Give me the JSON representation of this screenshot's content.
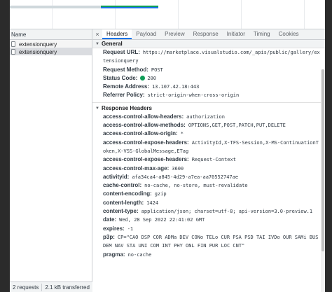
{
  "timeline": {
    "waiting_color": "#cfd8dc",
    "receiving_color": "#1a73e8"
  },
  "request_list": {
    "column_header": "Name",
    "items": [
      {
        "name": "extensionquery",
        "selected": false
      },
      {
        "name": "extensionquery",
        "selected": true
      }
    ],
    "status_bar": {
      "requests": "2 requests",
      "transferred": "2.1 kB transferred"
    }
  },
  "tabs": {
    "close_glyph": "×",
    "items": [
      "Headers",
      "Payload",
      "Preview",
      "Response",
      "Initiator",
      "Timing",
      "Cookies"
    ],
    "active": "Headers"
  },
  "general": {
    "title": "General",
    "fields": [
      {
        "key": "Request URL:",
        "value": "https://marketplace.visualstudio.com/_apis/public/gallery/extensionquery"
      },
      {
        "key": "Request Method:",
        "value": "POST"
      },
      {
        "key": "Status Code:",
        "value": "200",
        "status_color": "#0f9d58"
      },
      {
        "key": "Remote Address:",
        "value": "13.107.42.18:443"
      },
      {
        "key": "Referrer Policy:",
        "value": "strict-origin-when-cross-origin"
      }
    ]
  },
  "response_headers": {
    "title": "Response Headers",
    "fields": [
      {
        "key": "access-control-allow-headers:",
        "value": "authorization"
      },
      {
        "key": "access-control-allow-methods:",
        "value": "OPTIONS,GET,POST,PATCH,PUT,DELETE"
      },
      {
        "key": "access-control-allow-origin:",
        "value": "*"
      },
      {
        "key": "access-control-expose-headers:",
        "value": "ActivityId,X-TFS-Session,X-MS-ContinuationToken,X-VSS-GlobalMessage,ETag"
      },
      {
        "key": "access-control-expose-headers:",
        "value": "Request-Context"
      },
      {
        "key": "access-control-max-age:",
        "value": "3600"
      },
      {
        "key": "activityid:",
        "value": "afa34ca4-a845-4d29-a7ea-aa70552747ae"
      },
      {
        "key": "cache-control:",
        "value": "no-cache, no-store, must-revalidate"
      },
      {
        "key": "content-encoding:",
        "value": "gzip"
      },
      {
        "key": "content-length:",
        "value": "1424"
      },
      {
        "key": "content-type:",
        "value": "application/json; charset=utf-8; api-version=3.0-preview.1"
      },
      {
        "key": "date:",
        "value": "Wed, 28 Sep 2022 22:41:02 GMT"
      },
      {
        "key": "expires:",
        "value": "-1"
      },
      {
        "key": "p3p:",
        "value": "CP=\"CAO DSP COR ADMa DEV CONo TELo CUR PSA PSD TAI IVDo OUR SAMi BUS DEM NAV STA UNI COM INT PHY ONL FIN PUR LOC CNT\""
      },
      {
        "key": "pragma:",
        "value": "no-cache"
      }
    ]
  }
}
